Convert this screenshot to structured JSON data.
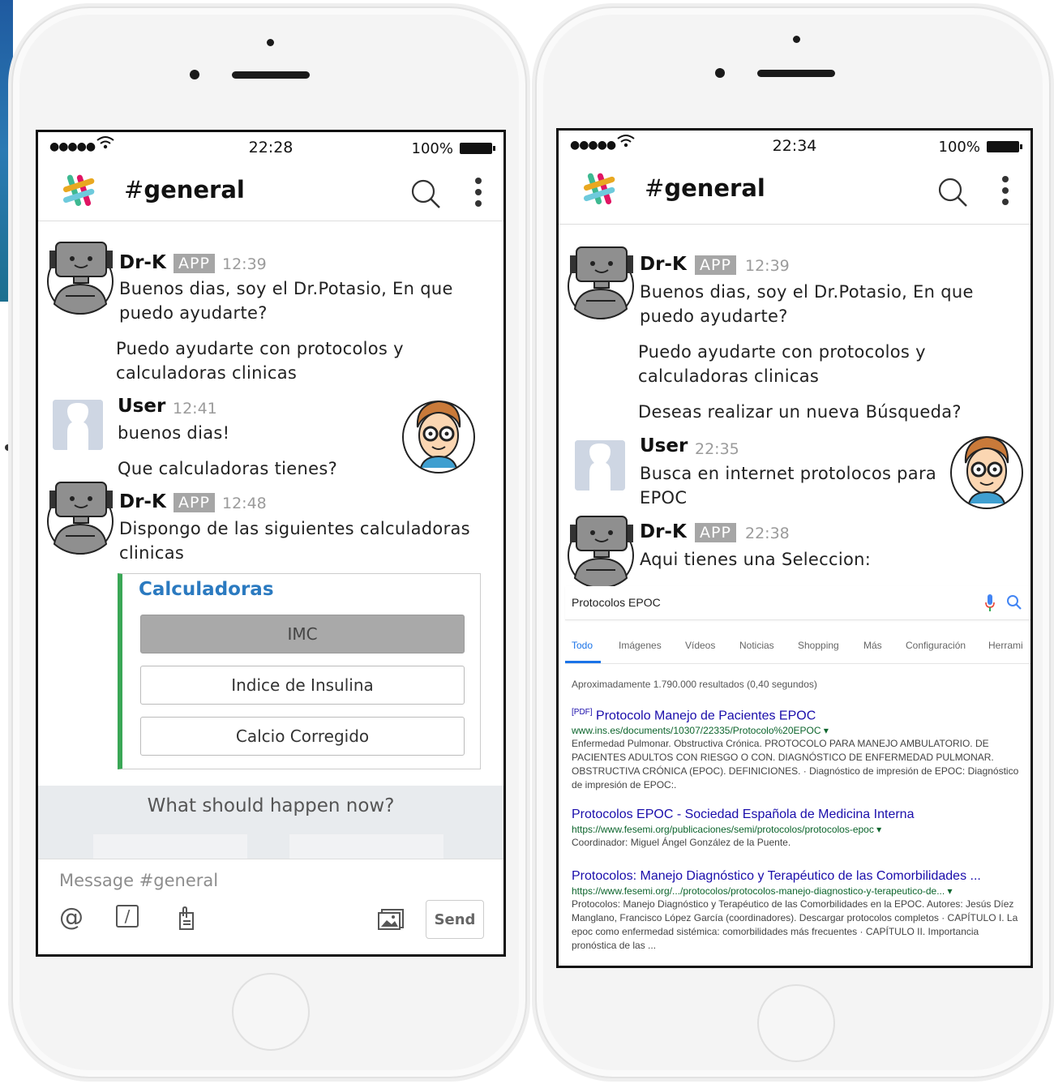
{
  "left_phone": {
    "status": {
      "time": "22:28",
      "battery": "100%"
    },
    "channel": {
      "hash": "#",
      "name": "general"
    },
    "messages": [
      {
        "name": "Dr-K",
        "badge": "APP",
        "time": "12:39",
        "lines": [
          "Buenos dias, soy el Dr.Potasio, En que",
          "puedo ayudarte?"
        ]
      },
      {
        "text": [
          "Puedo ayudarte con protocolos y",
          "calculadoras clinicas"
        ]
      },
      {
        "name": "User",
        "time": "12:41",
        "lines": [
          "buenos dias!"
        ]
      },
      {
        "text": [
          "Que calculadoras tienes?"
        ]
      },
      {
        "name": "Dr-K",
        "badge": "APP",
        "time": "12:48",
        "lines": [
          "Dispongo de las siguientes calculadoras",
          "clinicas"
        ]
      }
    ],
    "attachment": {
      "title": "Calculadoras",
      "buttons": [
        "IMC",
        "Indice de Insulina",
        "Calcio Corregido"
      ]
    },
    "prompt": "What should happen now?",
    "composer": {
      "placeholder": "Message #general",
      "send": "Send",
      "at": "@",
      "slash": "/"
    }
  },
  "right_phone": {
    "status": {
      "time": "22:34",
      "battery": "100%"
    },
    "channel": {
      "hash": "#",
      "name": "general"
    },
    "messages": [
      {
        "name": "Dr-K",
        "badge": "APP",
        "time": "12:39",
        "lines": [
          "Buenos dias, soy el Dr.Potasio, En que",
          "puedo ayudarte?"
        ]
      },
      {
        "text": [
          "Puedo ayudarte con protocolos y",
          "calculadoras clinicas"
        ]
      },
      {
        "text": [
          "Deseas realizar un nueva Búsqueda?"
        ]
      },
      {
        "name": "User",
        "time": "22:35",
        "lines": [
          "Busca en internet protolocos para",
          "EPOC"
        ]
      },
      {
        "name": "Dr-K",
        "badge": "APP",
        "time": "22:38",
        "lines": [
          "Aqui tienes una Seleccion:"
        ]
      }
    ],
    "google": {
      "query": "Protocolos EPOC",
      "tabs": [
        "Todo",
        "Imágenes",
        "Vídeos",
        "Noticias",
        "Shopping",
        "Más",
        "Configuración",
        "Herrami"
      ],
      "stats": "Aproximadamente 1.790.000 resultados (0,40 segundos)",
      "results": [
        {
          "tag": "[PDF]",
          "title": "Protocolo Manejo de Pacientes EPOC",
          "url": "www.ins.es/documents/10307/22335/Protocolo%20EPOC ▾",
          "snippet": "Enfermedad Pulmonar. Obstructiva Crónica. PROTOCOLO PARA MANEJO AMBULATORIO. DE PACIENTES ADULTOS CON RIESGO O CON. DIAGNÓSTICO DE ENFERMEDAD PULMONAR. OBSTRUCTIVA CRÓNICA (EPOC). DEFINICIONES. · Diagnóstico de impresión de EPOC: Diagnóstico de impresión de EPOC:."
        },
        {
          "tag": "",
          "title": "Protocolos EPOC - Sociedad Española de Medicina Interna",
          "url": "https://www.fesemi.org/publicaciones/semi/protocolos/protocolos-epoc ▾",
          "snippet": "Coordinador: Miguel Ángel González de la Puente."
        },
        {
          "tag": "",
          "title": "Protocolos: Manejo Diagnóstico y Terapéutico de las Comorbilidades ...",
          "url": "https://www.fesemi.org/.../protocolos/protocolos-manejo-diagnostico-y-terapeutico-de... ▾",
          "snippet": "Protocolos: Manejo Diagnóstico y Terapéutico de las Comorbilidades en la EPOC. Autores: Jesús Díez Manglano, Francisco López García (coordinadores). Descargar protocolos completos · CAPÍTULO I. La epoc como enfermedad sistémica: comorbilidades más frecuentes · CAPÍTULO II. Importancia pronóstica de las ..."
        }
      ]
    }
  },
  "colors": {
    "accent_green": "#3aa756",
    "link_blue": "#1a0dab",
    "title_blue": "#2b7ac0",
    "url_green": "#0d652d"
  },
  "icons": [
    "slack-logo-icon",
    "search-icon",
    "more-vert-icon",
    "robot-avatar-icon",
    "user-placeholder-icon",
    "doctor-avatar-icon",
    "at-icon",
    "slash-icon",
    "attach-file-icon",
    "image-icon",
    "mic-icon",
    "wifi-icon",
    "battery-icon"
  ]
}
